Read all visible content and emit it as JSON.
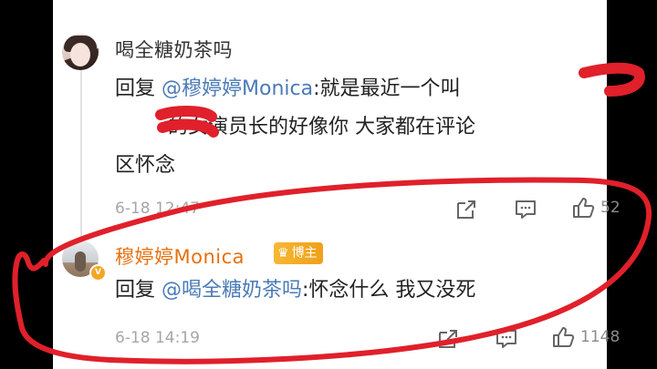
{
  "comments": [
    {
      "username": "喝全糖奶茶吗",
      "reply_prefix": "回复 ",
      "mention": "@穆婷婷Monica",
      "line1": ":就是最近一个叫",
      "line2": "的女演员长的好像你   大家都在评论",
      "line3": "区怀念",
      "time": "6-18 12:47",
      "like_count": "52"
    },
    {
      "username": "穆婷婷Monica",
      "badge": "博主",
      "reply_prefix": "回复 ",
      "mention": "@喝全糖奶茶吗",
      "body": ":怀念什么 我又没死",
      "time": "6-18 14:19",
      "like_count": "1148"
    }
  ],
  "icons": {
    "share": "share-icon",
    "comment": "comment-icon",
    "like": "thumbs-up-icon"
  },
  "colors": {
    "mention": "#4a7bb7",
    "blogger_name": "#e8700f",
    "annotation": "#e0202a"
  }
}
